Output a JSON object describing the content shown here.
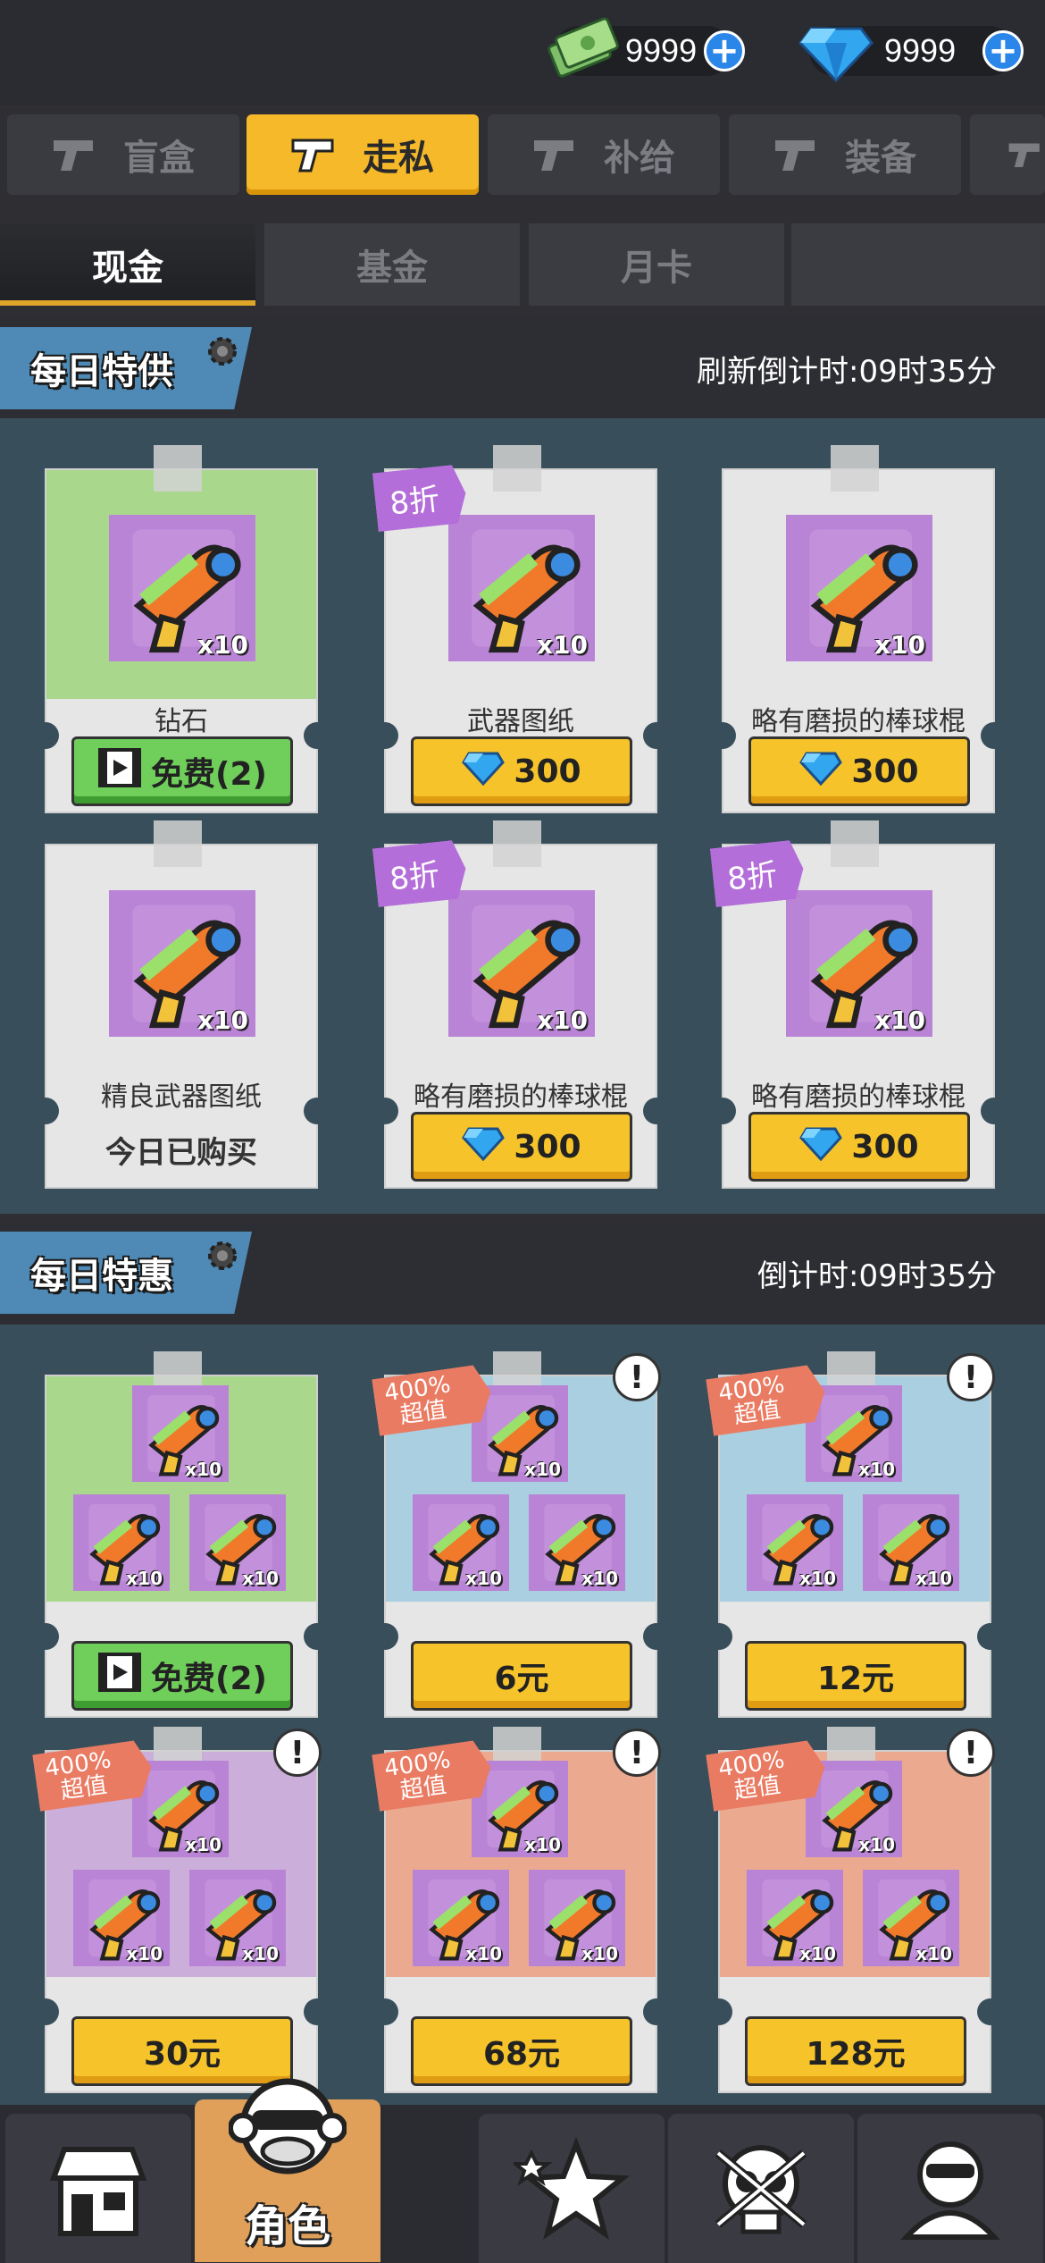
{
  "header": {
    "cash": {
      "icon": "cash-stack-icon",
      "value": "9999"
    },
    "gems": {
      "icon": "diamond-icon",
      "value": "9999"
    },
    "add_symbol": "+"
  },
  "top_tabs": [
    {
      "label": "盲盒",
      "icon": "pistol-icon"
    },
    {
      "label": "走私",
      "icon": "pistol-icon",
      "active": true
    },
    {
      "label": "补给",
      "icon": "pistol-icon"
    },
    {
      "label": "装备",
      "icon": "pistol-icon"
    }
  ],
  "sub_tabs": [
    {
      "label": "现金",
      "active": true
    },
    {
      "label": "基金"
    },
    {
      "label": "月卡"
    },
    {
      "label": ""
    }
  ],
  "daily_special": {
    "title": "每日特供",
    "timer": "刷新倒计时:09时35分",
    "cards": [
      {
        "name": "钻石",
        "qty": "x10",
        "button": "免费(2)",
        "button_type": "free-video",
        "bg": "#a9d88d"
      },
      {
        "name": "武器图纸",
        "qty": "x10",
        "discount": "8折",
        "button": "300",
        "button_type": "gem",
        "bg": "#e6e6e6"
      },
      {
        "name": "略有磨损的棒球棍",
        "qty": "x10",
        "button": "300",
        "button_type": "gem",
        "bg": "#e6e6e6"
      },
      {
        "name": "精良武器图纸",
        "qty": "x10",
        "status": "今日已购买",
        "bg": "#e6e6e6"
      },
      {
        "name": "略有磨损的棒球棍",
        "qty": "x10",
        "discount": "8折",
        "button": "300",
        "button_type": "gem",
        "bg": "#e6e6e6"
      },
      {
        "name": "略有磨损的棒球棍",
        "qty": "x10",
        "discount": "8折",
        "button": "300",
        "button_type": "gem",
        "bg": "#e6e6e6"
      }
    ]
  },
  "daily_deal": {
    "title": "每日特惠",
    "timer": "倒计时:09时35分",
    "cards": [
      {
        "qty": "x10",
        "button": "免费(2)",
        "button_type": "free-video",
        "bg": "#a9d88d"
      },
      {
        "qty": "x10",
        "tag": "400%超值",
        "tag_line1": "400%",
        "tag_line2": "超值",
        "alert": "!",
        "button": "6元",
        "bg": "#a9cfe0"
      },
      {
        "qty": "x10",
        "tag": "400%超值",
        "tag_line1": "400%",
        "tag_line2": "超值",
        "alert": "!",
        "button": "12元",
        "bg": "#a9cfe0"
      },
      {
        "qty": "x10",
        "tag": "400%超值",
        "tag_line1": "400%",
        "tag_line2": "超值",
        "alert": "!",
        "button": "30元",
        "bg": "#cbaed9"
      },
      {
        "qty": "x10",
        "tag": "400%超值",
        "tag_line1": "400%",
        "tag_line2": "超值",
        "alert": "!",
        "button": "68元",
        "bg": "#eba98f"
      },
      {
        "qty": "x10",
        "tag": "400%超值",
        "tag_line1": "400%",
        "tag_line2": "超值",
        "alert": "!",
        "button": "128元",
        "bg": "#eba98f"
      }
    ]
  },
  "bottom_nav": [
    {
      "icon": "shop-icon"
    },
    {
      "icon": "monkey-character-icon",
      "label": "角色",
      "active": true
    },
    {
      "icon": "star-badge-icon"
    },
    {
      "icon": "skull-icon"
    },
    {
      "icon": "character-silhouette-icon"
    }
  ],
  "colors": {
    "accent_yellow": "#f6b92a",
    "free_green": "#6fcf5a",
    "discount_purple": "#b46ed9",
    "value_tag_orange": "#ea7b63",
    "gem_blue": "#2a86e8"
  }
}
